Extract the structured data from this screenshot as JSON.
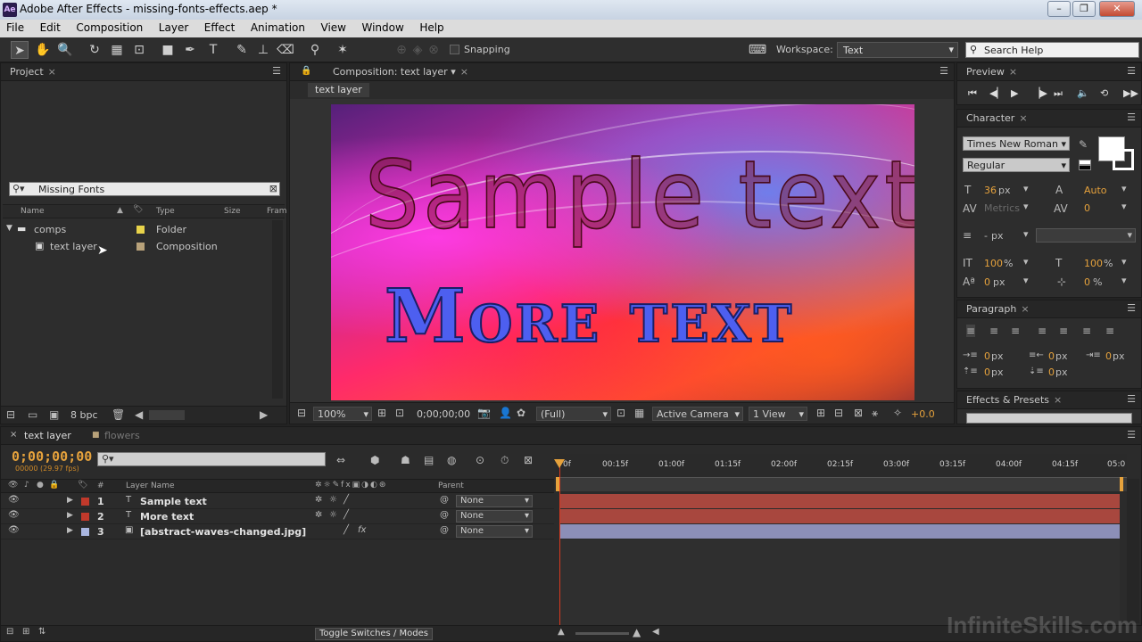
{
  "window": {
    "title": "Adobe After Effects - missing-fonts-effects.aep *",
    "logo": "Ae"
  },
  "menu": [
    "File",
    "Edit",
    "Composition",
    "Layer",
    "Effect",
    "Animation",
    "View",
    "Window",
    "Help"
  ],
  "toolbar": {
    "snapping": "Snapping",
    "workspace_label": "Workspace:",
    "workspace_value": "Text",
    "search_placeholder": "Search Help"
  },
  "project": {
    "tab": "Project",
    "search_value": "Missing Fonts",
    "columns": [
      "Name",
      "Type",
      "Size",
      "Fram"
    ],
    "items": [
      {
        "name": "comps",
        "type": "Folder",
        "label_color": "#e8d34a"
      },
      {
        "name": "text layer",
        "type": "Composition",
        "label_color": "#b8a27a"
      }
    ],
    "bpc": "8 bpc"
  },
  "composition": {
    "tab": "Composition: text layer",
    "breadcrumb": "text layer",
    "sample_text": "Sample text",
    "more_text": "More text",
    "zoom": "100%",
    "timecode": "0;00;00;00",
    "resolution": "(Full)",
    "camera": "Active Camera",
    "view": "1 View",
    "exposure": "+0.0"
  },
  "preview": {
    "tab": "Preview"
  },
  "character": {
    "tab": "Character",
    "font": "Times New Roman",
    "style": "Regular",
    "size": "36",
    "size_unit": "px",
    "leading": "Auto",
    "kerning": "Metrics",
    "tracking": "0",
    "stroke_width": "-",
    "stroke_unit": "px",
    "vert_scale": "100",
    "horiz_scale": "100",
    "pct": "%",
    "baseline": "0",
    "baseline_unit": "px",
    "tsume": "0",
    "tsume_unit": "%"
  },
  "paragraph": {
    "tab": "Paragraph",
    "indent_left": "0",
    "indent_first": "0",
    "indent_right": "0",
    "space_before": "0",
    "space_after": "0",
    "unit": "px"
  },
  "effects": {
    "tab": "Effects & Presets"
  },
  "timeline": {
    "tabs": [
      "text layer",
      "flowers"
    ],
    "timecode": "0;00;00;00",
    "fps": "00000 (29.97 fps)",
    "columns": {
      "num": "#",
      "name": "Layer Name",
      "parent": "Parent"
    },
    "ruler_ticks": [
      "0f",
      "00:15f",
      "01:00f",
      "01:15f",
      "02:00f",
      "02:15f",
      "03:00f",
      "03:15f",
      "04:00f",
      "04:15f",
      "05:0"
    ],
    "layers": [
      {
        "num": "1",
        "name": "Sample text",
        "parent": "None",
        "label_color": "#c0392b",
        "bar_color": "#a8473e"
      },
      {
        "num": "2",
        "name": "More text",
        "parent": "None",
        "label_color": "#c0392b",
        "bar_color": "#a8473e"
      },
      {
        "num": "3",
        "name": "[abstract-waves-changed.jpg]",
        "parent": "None",
        "label_color": "#aab6e0",
        "bar_color": "#8c8fb8"
      }
    ],
    "toggle_label": "Toggle Switches / Modes"
  },
  "watermark": "InfiniteSkills.com"
}
